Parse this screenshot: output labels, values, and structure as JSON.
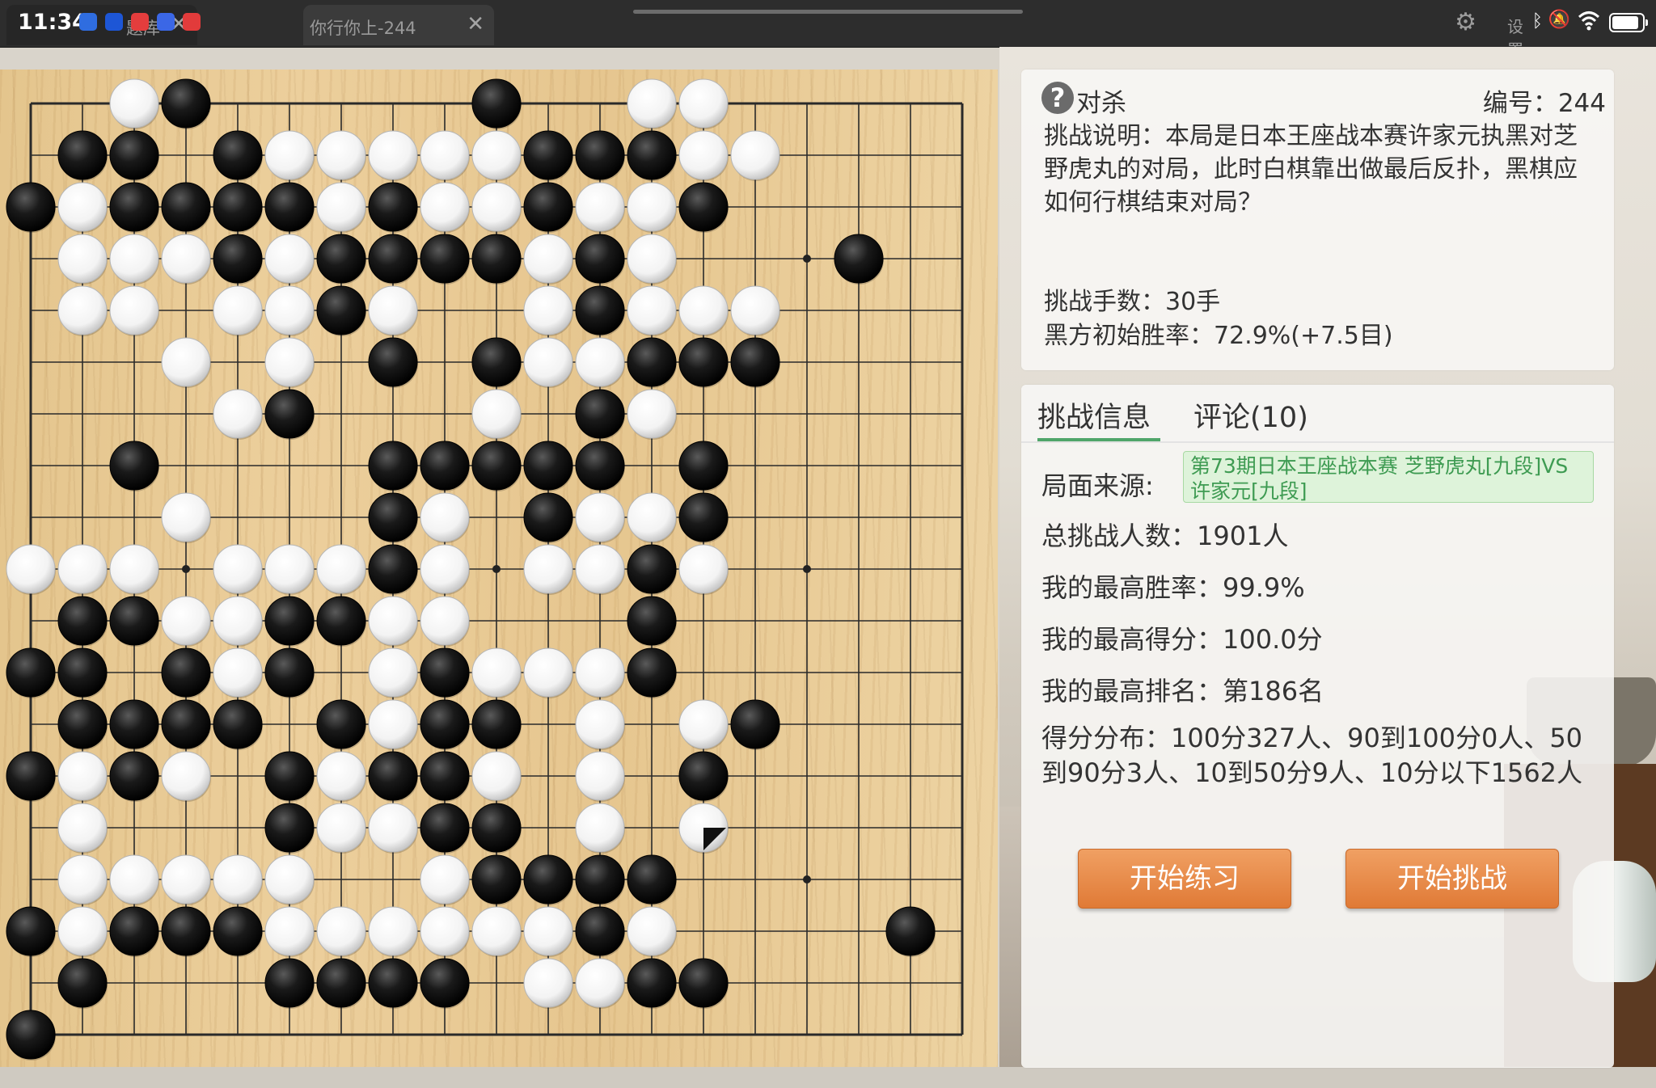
{
  "status_bar": {
    "time": "11:34",
    "settings_label": "设置",
    "tabs": [
      {
        "label": "题库",
        "close": "✕"
      },
      {
        "label": "你行你上-244",
        "close": "✕"
      }
    ]
  },
  "problem": {
    "type": "对杀",
    "id_label": "编号：244",
    "description": "挑战说明：本局是日本王座战本赛许家元执黑对芝野虎丸的对局，此时白棋靠出做最后反扑，黑棋应如何行棋结束对局？",
    "moves": "挑战手数：30手",
    "black_winrate": "黑方初始胜率：72.9%(+7.5目)"
  },
  "info_tabs": {
    "active": "挑战信息",
    "comments": "评论(10)"
  },
  "info": {
    "source_label": "局面来源:",
    "source_value": "第73期日本王座战本赛 芝野虎丸[九段]VS许家元[九段]",
    "total": "总挑战人数：1901人",
    "best_winrate": "我的最高胜率：99.9%",
    "best_score": "我的最高得分：100.0分",
    "best_rank": "我的最高排名：第186名",
    "distribution": "得分分布：100分327人、90到100分0人、50到90分3人、10到50分9人、10分以下1562人"
  },
  "buttons": {
    "practice": "开始练习",
    "challenge": "开始挑战"
  },
  "board": {
    "size": 19,
    "last_move": [
      13,
      14
    ],
    "rows": [
      "..WB.....B..WW.....",
      ".BB.BWWWWWBBBWW....",
      "BWBBBBWBWWBWWB.....",
      ".WWWBWBBBBWBW...B..",
      ".WW.WWBW..WBWWW....",
      "...W.W.B.BWWBBB....",
      "....WB...W.BW......",
      "..B....BBBBB.B.....",
      "...W...BW.BWWB.....",
      "WWW.WWWBW.WWBW.....",
      ".BBWWBBWW...B......",
      "BB.BWB.WBWWWB......",
      ".BBBB.BWBB.W.WB....",
      "BWBW.BWBBW.W.B.....",
      ".W...BWWBB.W.W.....",
      ".WWWWW..WBBBB......",
      "BWBBBWWWWWWBW....B.",
      ".B...BBBB.WWBB.....",
      "B.................."
    ]
  },
  "colors": {
    "accent_green": "#4fa56a",
    "button_orange": "#e8874a",
    "source_bg": "#def3da"
  }
}
